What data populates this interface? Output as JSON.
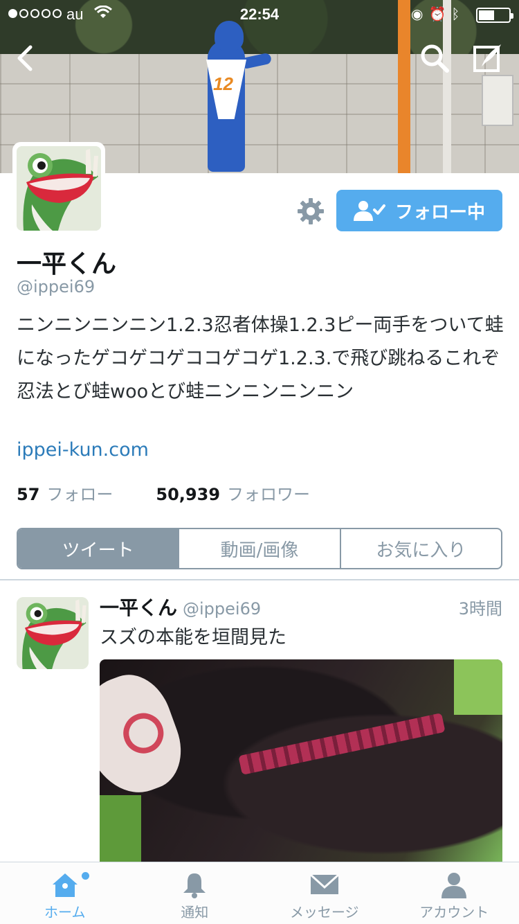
{
  "status_bar": {
    "carrier": "au",
    "time": "22:54",
    "signal_bars_filled": 1,
    "signal_bars_total": 5
  },
  "header": {
    "back_icon": "chevron-left-icon",
    "search_icon": "search-icon",
    "compose_icon": "compose-tweet-icon"
  },
  "profile": {
    "name": "一平くん",
    "handle": "@ippei69",
    "bio": "ニンニンニンニン1.2.3忍者体操1.2.3ピー両手をついて蛙になったゲコゲコゲココゲコゲ1.2.3.で飛び跳ねるこれぞ忍法とび蛙wooとび蛙ニンニンニンニン",
    "website": "ippei-kun.com",
    "following_count": "57",
    "following_label": "フォロー",
    "followers_count": "50,939",
    "followers_label": "フォロワー",
    "follow_button_label": "フォロー中",
    "accent_color": "#55acee"
  },
  "tabs": [
    {
      "label": "ツイート",
      "active": true
    },
    {
      "label": "動画/画像",
      "active": false
    },
    {
      "label": "お気に入り",
      "active": false
    }
  ],
  "tweet": {
    "name": "一平くん",
    "handle": "@ippei69",
    "time": "3時間",
    "text": "スズの本能を垣間見た"
  },
  "tabbar": [
    {
      "label": "ホーム",
      "icon": "home-icon",
      "active": true
    },
    {
      "label": "通知",
      "icon": "bell-icon",
      "active": false
    },
    {
      "label": "メッセージ",
      "icon": "envelope-icon",
      "active": false
    },
    {
      "label": "アカウント",
      "icon": "person-icon",
      "active": false
    }
  ]
}
